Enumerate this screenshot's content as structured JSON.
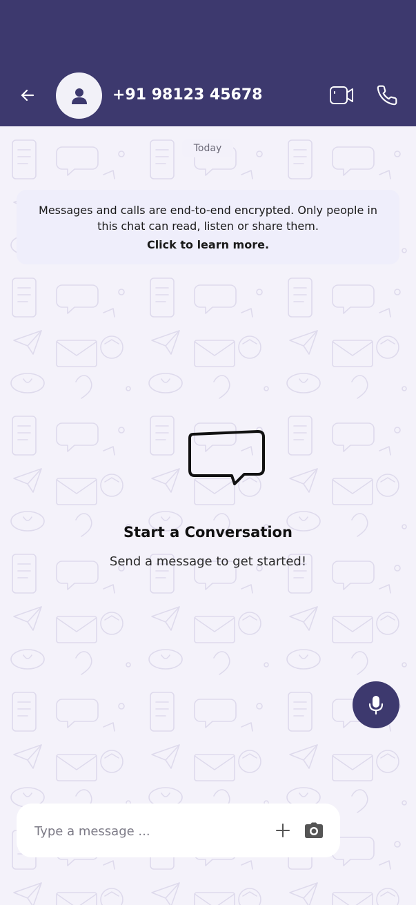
{
  "header": {
    "contact_name": "+91 98123 45678",
    "back_icon": "arrow-left-icon",
    "avatar_icon": "person-icon",
    "video_icon": "video-call-icon",
    "call_icon": "phone-icon",
    "background_color": "#3d396e"
  },
  "chat": {
    "date_label": "Today",
    "encryption_notice": "Messages and calls are end-to-end encrypted. Only people in this chat can read, listen or share them.",
    "learn_more": "Click to learn more.",
    "empty_state": {
      "icon": "chat-bubble-icon",
      "title": "Start a Conversation",
      "subtitle": "Send a message to get started!"
    }
  },
  "composer": {
    "placeholder": "Type a message ...",
    "value": "",
    "attach_icon": "plus-icon",
    "camera_icon": "camera-icon",
    "mic_icon": "microphone-icon"
  },
  "colors": {
    "accent": "#3d396e",
    "notice_bg": "#efeefb",
    "chat_bg": "#f4f2fa"
  }
}
